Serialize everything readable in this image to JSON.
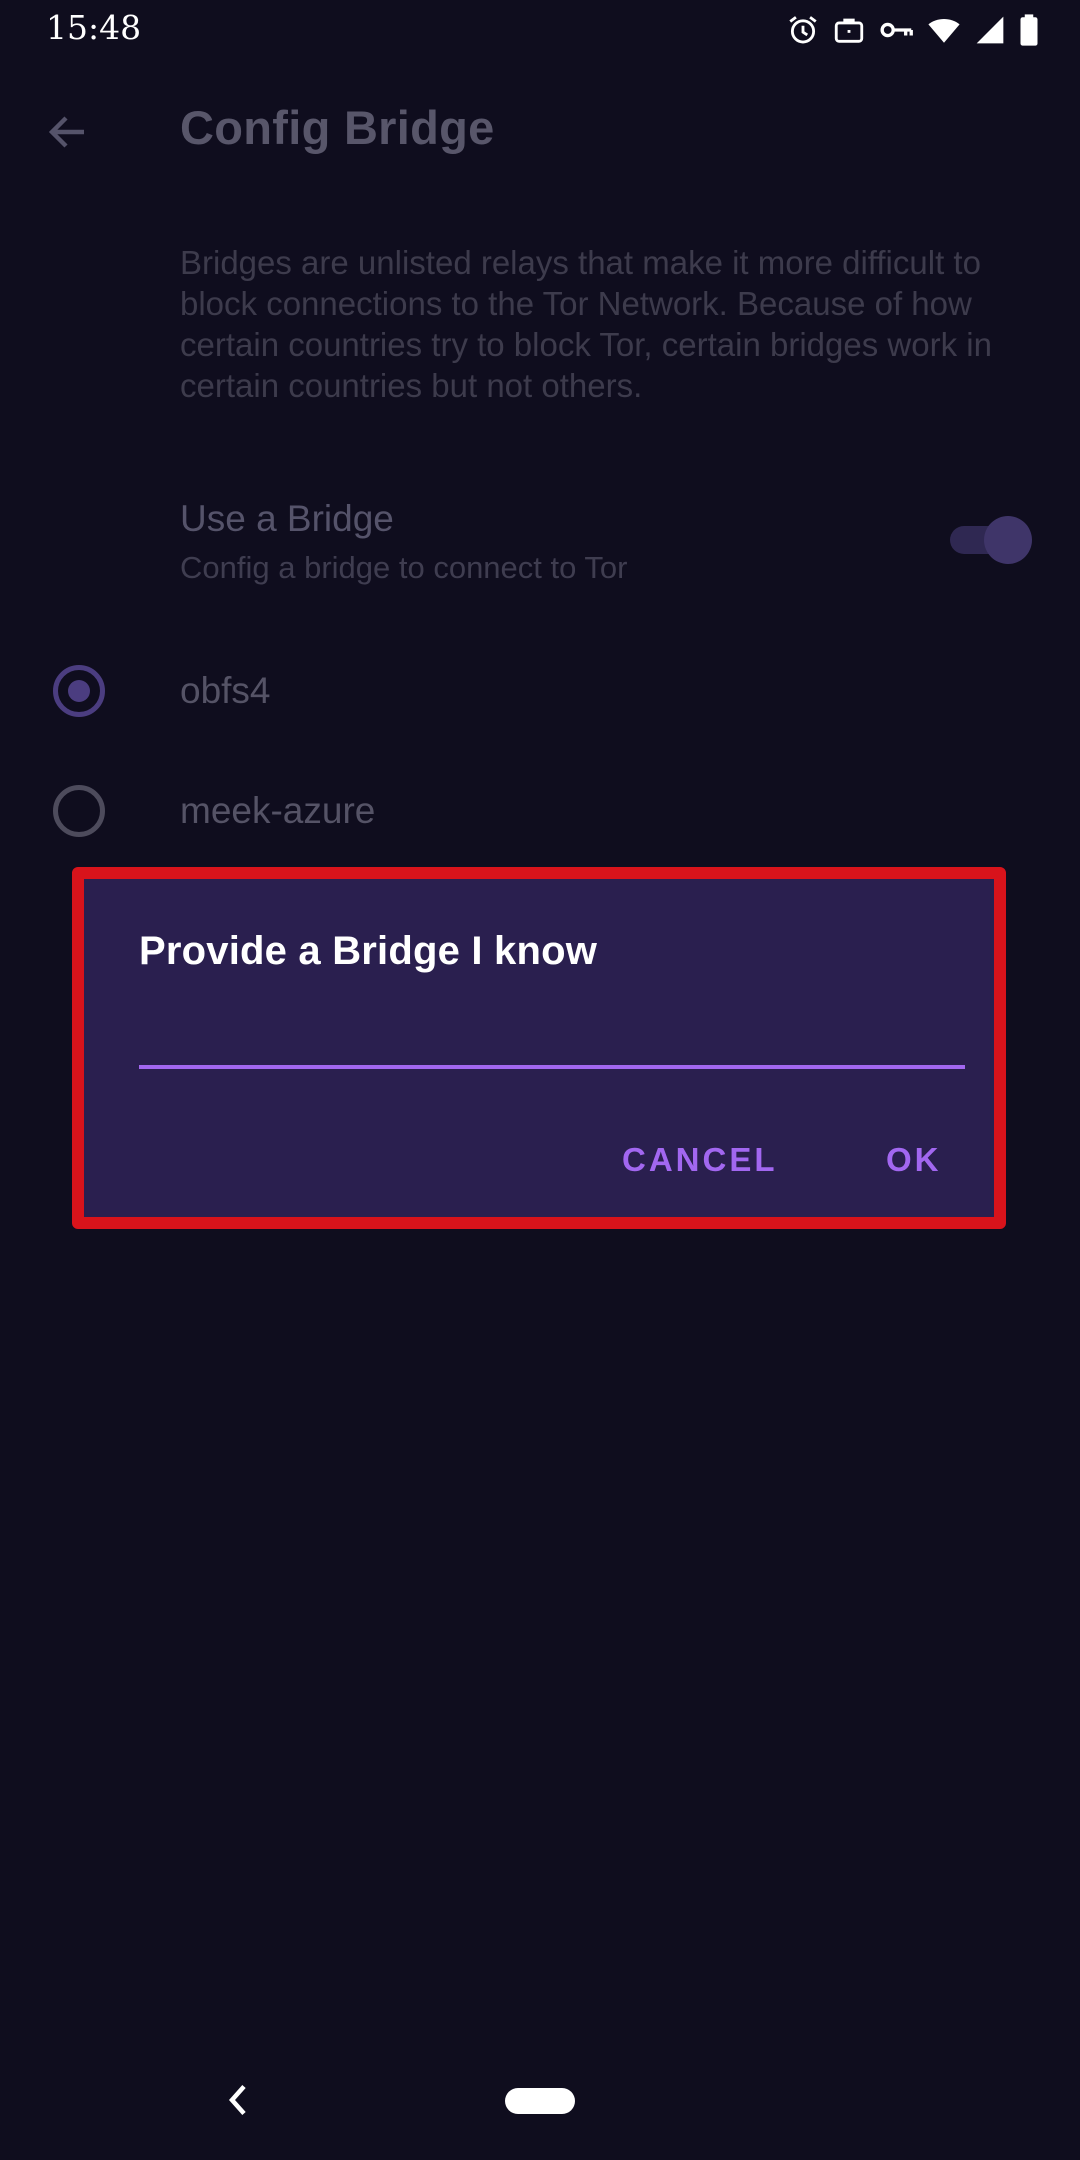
{
  "status_bar": {
    "time": "15:48",
    "icons": [
      "alarm-icon",
      "work-briefcase-icon",
      "vpn-key-icon",
      "wifi-icon",
      "cell-signal-icon",
      "battery-icon"
    ]
  },
  "toolbar": {
    "back_icon": "arrow-left-icon",
    "title": "Config Bridge"
  },
  "content": {
    "description": "Bridges are unlisted relays that make it more difficult to block connections to the Tor Network. Because of how certain countries try to block Tor, certain bridges work in certain countries but not others.",
    "use_bridge": {
      "title": "Use a Bridge",
      "summary": "Config a bridge to connect to Tor",
      "enabled": true
    },
    "bridge_options": [
      {
        "label": "obfs4",
        "selected": true
      },
      {
        "label": "meek-azure",
        "selected": false
      }
    ]
  },
  "dialog": {
    "title": "Provide a Bridge I know",
    "input_value": "",
    "cancel_label": "CANCEL",
    "ok_label": "OK"
  },
  "colors": {
    "background": "#0f0d1e",
    "dialog_background": "#2a1f4f",
    "accent": "#a267f0",
    "highlight_border": "#d8131b"
  }
}
